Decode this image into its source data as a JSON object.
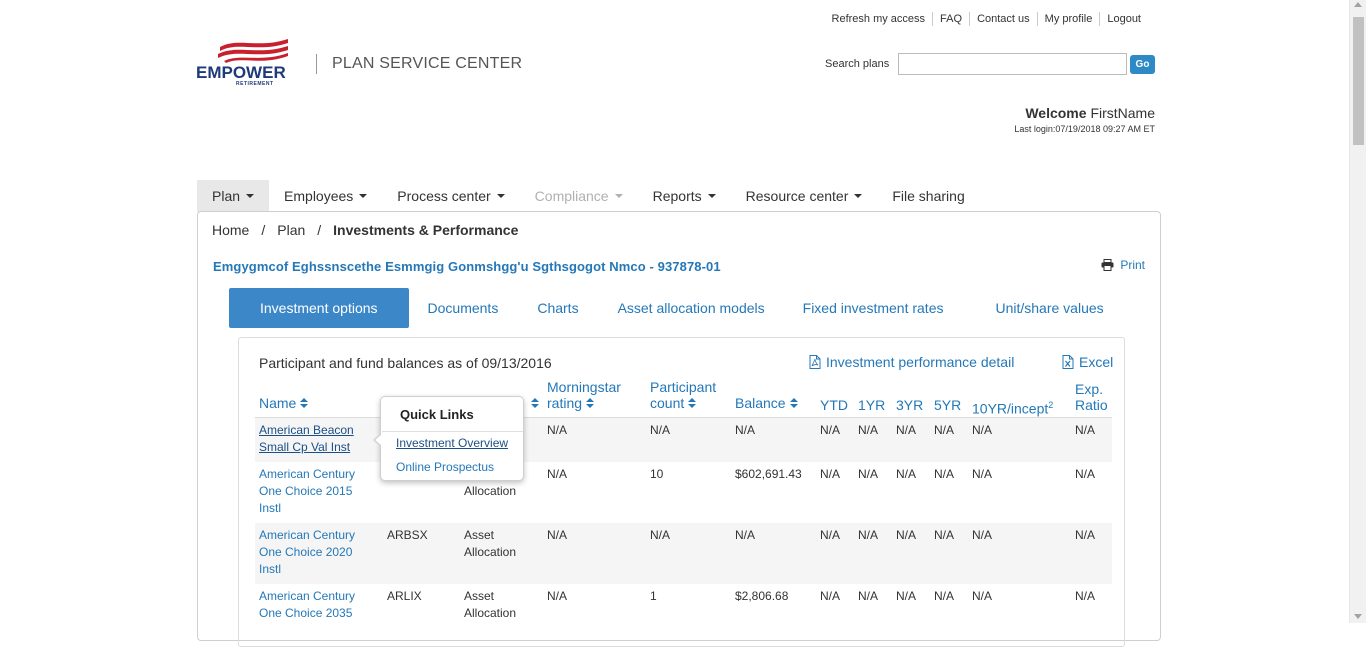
{
  "header": {
    "util_links": [
      "Refresh my access",
      "FAQ",
      "Contact us",
      "My profile",
      "Logout"
    ],
    "logo_brand": "EMPOWER",
    "logo_sub": "RETIREMENT",
    "app_title": "PLAN SERVICE CENTER",
    "search_label": "Search plans",
    "search_value": "",
    "go_label": "Go",
    "welcome_label": "Welcome",
    "welcome_name": "FirstName",
    "last_login": "Last login:07/19/2018 09:27 AM ET"
  },
  "nav": {
    "items": [
      {
        "label": "Plan",
        "caret": true,
        "active": true,
        "disabled": false
      },
      {
        "label": "Employees",
        "caret": true,
        "active": false,
        "disabled": false
      },
      {
        "label": "Process center",
        "caret": true,
        "active": false,
        "disabled": false
      },
      {
        "label": "Compliance",
        "caret": true,
        "active": false,
        "disabled": true
      },
      {
        "label": "Reports",
        "caret": true,
        "active": false,
        "disabled": false
      },
      {
        "label": "Resource center",
        "caret": true,
        "active": false,
        "disabled": false
      },
      {
        "label": "File sharing",
        "caret": false,
        "active": false,
        "disabled": false
      }
    ]
  },
  "breadcrumb": {
    "home": "Home",
    "plan": "Plan",
    "current": "Investments & Performance",
    "sep": "/"
  },
  "plan_name": "Emgygmcof Eghssnscethe Esmmgig Gonmshgg'u Sgthsgogot Nmco - 937878-01",
  "print_label": "Print",
  "tabs": [
    "Investment options",
    "Documents",
    "Charts",
    "Asset allocation models",
    "Fixed investment rates",
    "Unit/share values"
  ],
  "balances": {
    "title": "Participant and fund balances as of 09/13/2016",
    "perf_link": "Investment performance detail",
    "excel_link": "Excel"
  },
  "table": {
    "headers": {
      "name": "Name",
      "morningstar": [
        "Morningstar",
        "rating"
      ],
      "participant": [
        "Participant",
        "count"
      ],
      "balance": "Balance",
      "ytd": "YTD",
      "yr1": "1YR",
      "yr3": "3YR",
      "yr5": "5YR",
      "yr10": "10YR/incept",
      "yr10_sup": "2",
      "exp": [
        "Exp.",
        "Ratio"
      ]
    },
    "rows": [
      {
        "name": [
          "American Beacon",
          "Small Cp Val Inst"
        ],
        "ticker": "",
        "category": [],
        "morningstar": "N/A",
        "count": "N/A",
        "balance": "N/A",
        "ytd": "N/A",
        "yr1": "N/A",
        "yr3": "N/A",
        "yr5": "N/A",
        "yr10": "N/A",
        "exp": "N/A"
      },
      {
        "name": [
          "American Century",
          "One Choice 2015",
          "Instl"
        ],
        "ticker": "",
        "category": [
          "",
          "Allocation"
        ],
        "morningstar": "N/A",
        "count": "10",
        "balance": "$602,691.43",
        "ytd": "N/A",
        "yr1": "N/A",
        "yr3": "N/A",
        "yr5": "N/A",
        "yr10": "N/A",
        "exp": "N/A"
      },
      {
        "name": [
          "American Century",
          "One Choice 2020",
          "Instl"
        ],
        "ticker": "ARBSX",
        "category": [
          "Asset",
          "Allocation"
        ],
        "morningstar": "N/A",
        "count": "N/A",
        "balance": "N/A",
        "ytd": "N/A",
        "yr1": "N/A",
        "yr3": "N/A",
        "yr5": "N/A",
        "yr10": "N/A",
        "exp": "N/A"
      },
      {
        "name": [
          "American Century",
          "One Choice 2035"
        ],
        "ticker": "ARLIX",
        "category": [
          "Asset",
          "Allocation"
        ],
        "morningstar": "N/A",
        "count": "1",
        "balance": "$2,806.68",
        "ytd": "N/A",
        "yr1": "N/A",
        "yr3": "N/A",
        "yr5": "N/A",
        "yr10": "N/A",
        "exp": "N/A"
      }
    ]
  },
  "quick_links": {
    "title": "Quick Links",
    "links": [
      "Investment Overview",
      "Online Prospectus"
    ]
  },
  "colors": {
    "brand_navy": "#1f3a7a",
    "brand_red": "#c8202f",
    "link_blue": "#2478b8",
    "tab_active": "#3b87c8",
    "go_button": "#2d8ac7"
  }
}
